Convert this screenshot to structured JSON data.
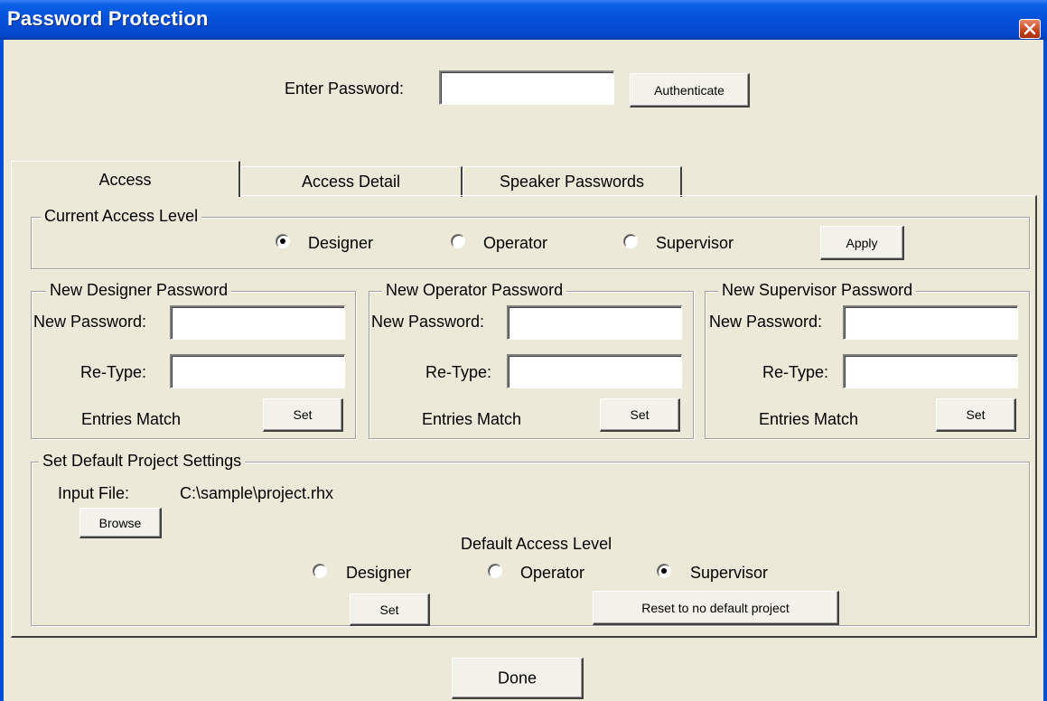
{
  "window": {
    "title": "Password Protection"
  },
  "auth": {
    "enter_password_label": "Enter Password:",
    "password_value": "",
    "authenticate_label": "Authenticate"
  },
  "tabs": [
    {
      "label": "Access",
      "selected": true
    },
    {
      "label": "Access Detail",
      "selected": false
    },
    {
      "label": "Speaker Passwords",
      "selected": false
    }
  ],
  "current_access": {
    "group_title": "Current Access Level",
    "options": [
      {
        "label": "Designer",
        "selected": true
      },
      {
        "label": "Operator",
        "selected": false
      },
      {
        "label": "Supervisor",
        "selected": false
      }
    ],
    "apply_label": "Apply"
  },
  "password_groups": [
    {
      "title": "New Designer Password",
      "new_password_label": "New Password:",
      "retype_label": "Re-Type:",
      "status": "Entries Match",
      "set_label": "Set",
      "new_password_value": "",
      "retype_value": ""
    },
    {
      "title": "New Operator Password",
      "new_password_label": "New Password:",
      "retype_label": "Re-Type:",
      "status": "Entries Match",
      "set_label": "Set",
      "new_password_value": "",
      "retype_value": ""
    },
    {
      "title": "New Supervisor Password",
      "new_password_label": "New Password:",
      "retype_label": "Re-Type:",
      "status": "Entries Match",
      "set_label": "Set",
      "new_password_value": "",
      "retype_value": ""
    }
  ],
  "default_project": {
    "group_title": "Set Default Project Settings",
    "input_file_label": "Input File:",
    "input_file_path": "C:\\sample\\project.rhx",
    "browse_label": "Browse",
    "default_access_label": "Default Access Level",
    "options": [
      {
        "label": "Designer",
        "selected": false
      },
      {
        "label": "Operator",
        "selected": false
      },
      {
        "label": "Supervisor",
        "selected": true
      }
    ],
    "set_label": "Set",
    "reset_label": "Reset to no default project"
  },
  "footer": {
    "done_label": "Done"
  }
}
